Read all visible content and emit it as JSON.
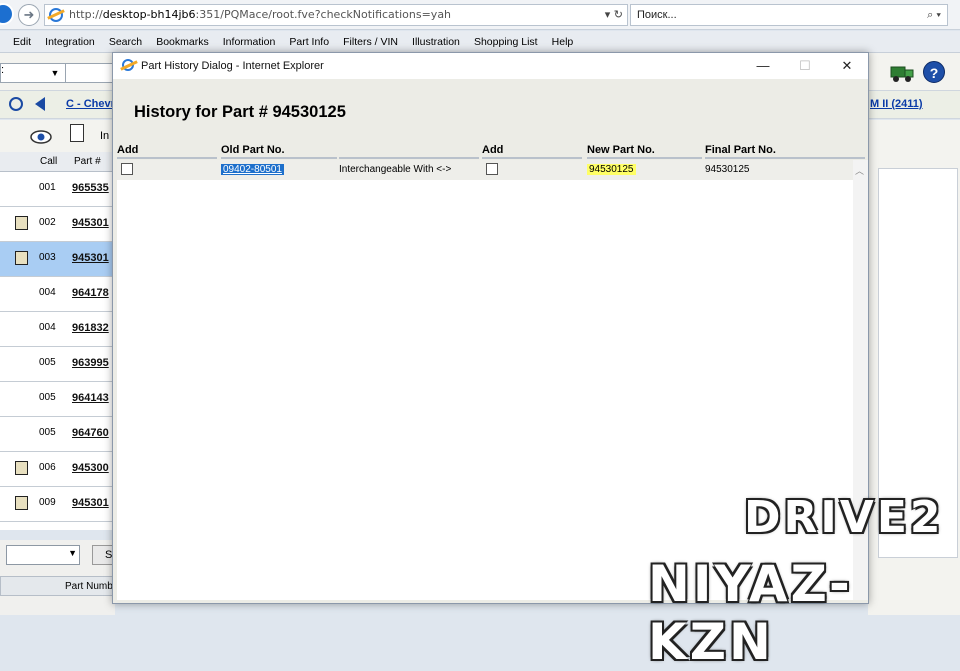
{
  "browser": {
    "url_prefix": "http://",
    "url_host": "desktop-bh14jb6",
    "url_path": ":351/PQMace/root.fve?checkNotifications=yah",
    "url_controls": "▾ ↻",
    "search_placeholder": "Поиск...",
    "search_icon": "⌕ ▾"
  },
  "menu": [
    "Edit",
    "Integration",
    "Search",
    "Bookmarks",
    "Information",
    "Part Info",
    "Filters / VIN",
    "Illustration",
    "Shopping List",
    "Help"
  ],
  "app": {
    "combo_value": ":",
    "breadcrumb_left": "C - Chevr",
    "breadcrumb_right": "M II (2411)",
    "info_label": "In",
    "left_table": {
      "col_call": "Call",
      "col_part": "Part #",
      "rows": [
        {
          "call": "001",
          "part": "965535",
          "icon": false,
          "selected": false
        },
        {
          "call": "002",
          "part": "945301",
          "icon": true,
          "selected": false
        },
        {
          "call": "003",
          "part": "945301",
          "icon": true,
          "selected": true
        },
        {
          "call": "004",
          "part": "964178",
          "icon": false,
          "selected": false
        },
        {
          "call": "004",
          "part": "961832",
          "icon": false,
          "selected": false
        },
        {
          "call": "005",
          "part": "963995",
          "icon": false,
          "selected": false
        },
        {
          "call": "005",
          "part": "964143",
          "icon": false,
          "selected": false
        },
        {
          "call": "005",
          "part": "964760",
          "icon": false,
          "selected": false
        },
        {
          "call": "006",
          "part": "945300",
          "icon": true,
          "selected": false
        },
        {
          "call": "009",
          "part": "945301",
          "icon": true,
          "selected": false
        }
      ]
    },
    "bottom_button": "S",
    "bottom_column": "Part Numb"
  },
  "dialog": {
    "title": "Part History Dialog - Internet Explorer",
    "minimize": "—",
    "maximize": "☐",
    "close": "✕",
    "heading": "History for Part # 94530125",
    "columns": {
      "add1": "Add",
      "old_part": "Old Part No.",
      "relation": "",
      "add2": "Add",
      "new_part": "New Part No.",
      "final_part": "Final Part No."
    },
    "rows": [
      {
        "old_part": "09402-80501",
        "relation": "Interchangeable With <->",
        "new_part": "94530125",
        "final_part": "94530125"
      }
    ]
  },
  "watermark": {
    "top": "DRIVE2",
    "bottom": "NIYAZ-KZN"
  },
  "colors": {
    "selection_blue": "#1d6fcb",
    "highlight_yellow": "#ffff66",
    "link_blue": "#0b3ba8",
    "selected_row": "#a9cdf3"
  }
}
